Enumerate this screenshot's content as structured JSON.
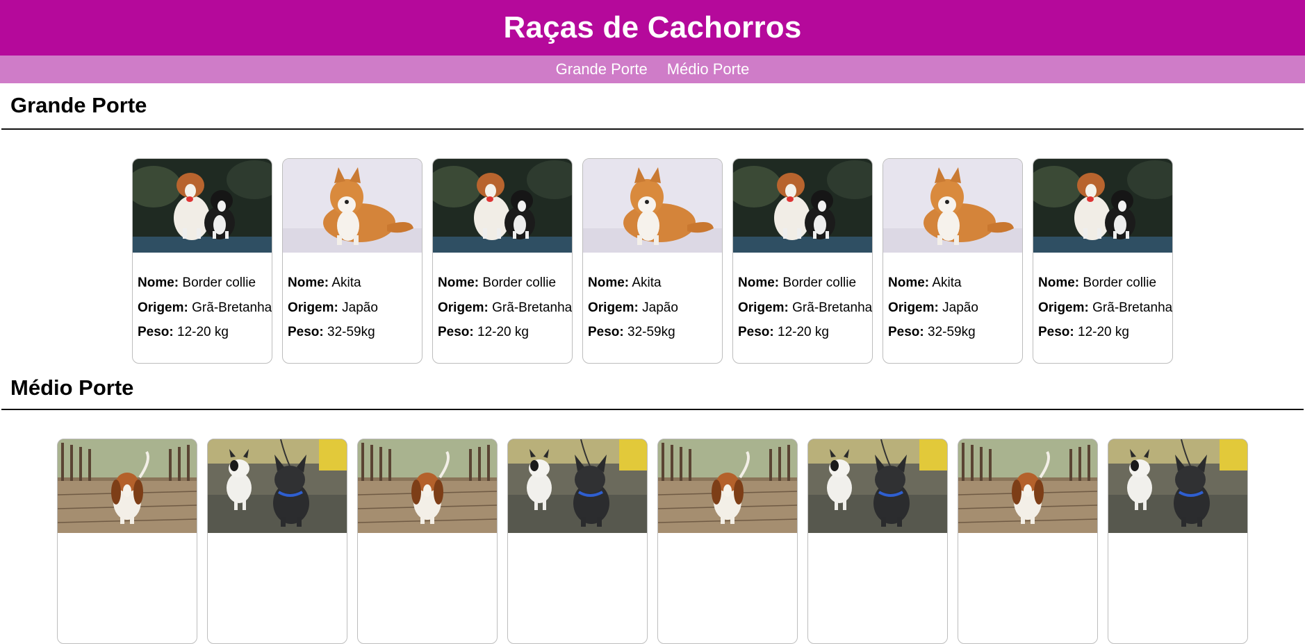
{
  "header": {
    "title": "Raças de Cachorros"
  },
  "nav": {
    "items": [
      "Grande Porte",
      "Médio Porte"
    ]
  },
  "labels": {
    "nome": "Nome:",
    "origem": "Origem:",
    "peso": "Peso:"
  },
  "sections": {
    "grande": {
      "title": "Grande Porte",
      "cards": [
        {
          "photo": "border-collie-photo",
          "nome": "Border collie",
          "origem": "Grã-Bretanha",
          "peso": "12-20 kg"
        },
        {
          "photo": "akita-photo",
          "nome": "Akita",
          "origem": "Japão",
          "peso": "32-59kg"
        },
        {
          "photo": "border-collie-photo",
          "nome": "Border collie",
          "origem": "Grã-Bretanha",
          "peso": "12-20 kg"
        },
        {
          "photo": "akita-photo",
          "nome": "Akita",
          "origem": "Japão",
          "peso": "32-59kg"
        },
        {
          "photo": "border-collie-photo",
          "nome": "Border collie",
          "origem": "Grã-Bretanha",
          "peso": "12-20 kg"
        },
        {
          "photo": "akita-photo",
          "nome": "Akita",
          "origem": "Japão",
          "peso": "32-59kg"
        },
        {
          "photo": "border-collie-photo",
          "nome": "Border collie",
          "origem": "Grã-Bretanha",
          "peso": "12-20 kg"
        }
      ]
    },
    "medio": {
      "title": "Médio Porte",
      "cards": [
        {
          "photo": "basset-hound-photo"
        },
        {
          "photo": "french-bulldogs-photo"
        },
        {
          "photo": "basset-hound-photo"
        },
        {
          "photo": "french-bulldogs-photo"
        },
        {
          "photo": "basset-hound-photo"
        },
        {
          "photo": "french-bulldogs-photo"
        },
        {
          "photo": "basset-hound-photo"
        },
        {
          "photo": "french-bulldogs-photo"
        }
      ]
    }
  },
  "colors": {
    "header": "#b5099b",
    "nav": "#cf7cc8"
  }
}
